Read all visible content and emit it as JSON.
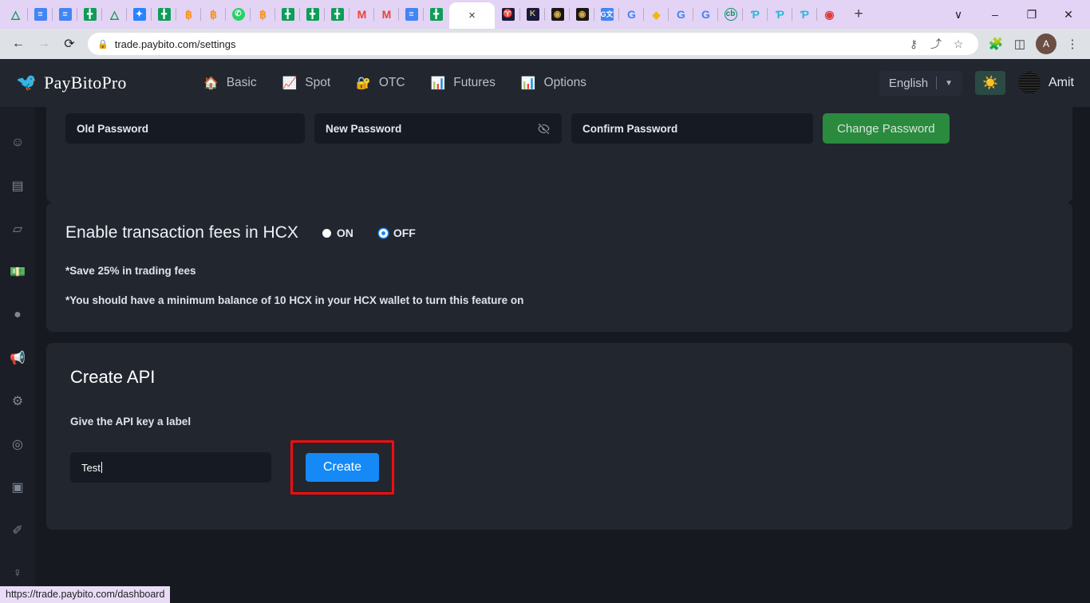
{
  "browser": {
    "tabs_mini": [
      {
        "name": "drive-tab",
        "icon": "drive-icon",
        "glyph": "△",
        "cls": "drive"
      },
      {
        "name": "docs-tab",
        "icon": "docs-icon",
        "glyph": "≡",
        "cls": "docs"
      },
      {
        "name": "docs-tab-2",
        "icon": "docs-icon",
        "glyph": "≡",
        "cls": "docs"
      },
      {
        "name": "sheets-tab",
        "icon": "sheets-icon",
        "glyph": "╋",
        "cls": "sheets"
      },
      {
        "name": "drive-tab-2",
        "icon": "drive-icon",
        "glyph": "△",
        "cls": "drive"
      },
      {
        "name": "jira-tab",
        "icon": "jira-icon",
        "glyph": "✦",
        "cls": "jira"
      },
      {
        "name": "sheets-tab-2",
        "icon": "sheets-icon",
        "glyph": "╋",
        "cls": "sheets"
      },
      {
        "name": "bitcoin-tab",
        "icon": "bitcoin-icon",
        "glyph": "฿",
        "cls": "btc"
      },
      {
        "name": "bitcoin-tab-2",
        "icon": "bitcoin-icon",
        "glyph": "฿",
        "cls": "btc"
      },
      {
        "name": "whatsapp-tab",
        "icon": "whatsapp-icon",
        "glyph": "✆",
        "cls": "wa"
      },
      {
        "name": "bitcoin-tab-3",
        "icon": "bitcoin-icon",
        "glyph": "฿",
        "cls": "btc"
      },
      {
        "name": "sheets-tab-3",
        "icon": "sheets-icon",
        "glyph": "╋",
        "cls": "sheets"
      },
      {
        "name": "sheets-tab-4",
        "icon": "sheets-icon",
        "glyph": "╋",
        "cls": "sheets"
      },
      {
        "name": "sheets-tab-5",
        "icon": "sheets-icon",
        "glyph": "╋",
        "cls": "sheets"
      },
      {
        "name": "gmail-tab",
        "icon": "gmail-icon",
        "glyph": "M",
        "cls": "gmail"
      },
      {
        "name": "gmail-tab-2",
        "icon": "gmail-icon",
        "glyph": "M",
        "cls": "gmail"
      },
      {
        "name": "docs-tab-3",
        "icon": "docs-icon",
        "glyph": "≡",
        "cls": "docs"
      },
      {
        "name": "sheets-tab-6",
        "icon": "sheets-icon",
        "glyph": "╋",
        "cls": "sheets"
      }
    ],
    "tabs_mini_right": [
      {
        "name": "paybito-tab",
        "icon": "paybito-icon",
        "glyph": "♈",
        "cls": "dark"
      },
      {
        "name": "kraken-tab",
        "icon": "kraken-icon",
        "glyph": "K",
        "cls": "dark"
      },
      {
        "name": "coin-tab",
        "icon": "coin-icon",
        "glyph": "◉",
        "cls": "gold"
      },
      {
        "name": "coin-tab-2",
        "icon": "coin-icon",
        "glyph": "◉",
        "cls": "gold"
      },
      {
        "name": "translate-tab",
        "icon": "google-translate-icon",
        "glyph": "G文",
        "cls": "gtrans"
      },
      {
        "name": "google-tab",
        "icon": "google-icon",
        "glyph": "G",
        "cls": "goog"
      },
      {
        "name": "binance-tab",
        "icon": "binance-icon",
        "glyph": "◆",
        "cls": "binance"
      },
      {
        "name": "google-tab-2",
        "icon": "google-icon",
        "glyph": "G",
        "cls": "goog"
      },
      {
        "name": "google-tab-3",
        "icon": "google-icon",
        "glyph": "G",
        "cls": "goog"
      },
      {
        "name": "coinbase-tab",
        "icon": "coinbase-icon",
        "glyph": "cb",
        "cls": "coinb"
      },
      {
        "name": "paybito-tab-2",
        "icon": "paybito-icon",
        "glyph": "Ƥ",
        "cls": "pay"
      },
      {
        "name": "paybito-tab-3",
        "icon": "paybito-icon",
        "glyph": "Ƥ",
        "cls": "pay"
      },
      {
        "name": "paybito-tab-4",
        "icon": "paybito-icon",
        "glyph": "Ƥ",
        "cls": "pay"
      },
      {
        "name": "record-tab",
        "icon": "record-icon",
        "glyph": "◉",
        "cls": "rec"
      }
    ],
    "active_tab_close": "×",
    "new_tab": "+",
    "window_controls": {
      "list": "∨",
      "minimize": "–",
      "maximize": "❐",
      "close": "✕"
    },
    "back": "←",
    "forward": "→",
    "reload": "⟳",
    "lock": "🔒",
    "url": "trade.paybito.com/settings",
    "omnibox_icons": {
      "password_key": "⚷",
      "share": "⤴",
      "bookmark": "☆"
    },
    "toolbar_icons": {
      "extensions": "🧩",
      "sidepanel": "◫",
      "menu": "⋮"
    },
    "profile_initial": "A"
  },
  "app_header": {
    "brand_logo_icon": "swallow-bird-logo",
    "brand_name": "PayBitoPro",
    "nav": [
      {
        "label": "Basic",
        "icon": "🏠"
      },
      {
        "label": "Spot",
        "icon": "📈"
      },
      {
        "label": "OTC",
        "icon": "🔐"
      },
      {
        "label": "Futures",
        "icon": "📊"
      },
      {
        "label": "Options",
        "icon": "📊"
      }
    ],
    "language": "English",
    "language_caret": "▼",
    "theme_icon": "☀",
    "user_name": "Amit"
  },
  "sidebar": {
    "items": [
      {
        "name": "profile",
        "icon": "ⓘ",
        "glyph": "☺"
      },
      {
        "name": "cards",
        "icon": "card-icon",
        "glyph": "▤"
      },
      {
        "name": "deposit",
        "icon": "folder-icon",
        "glyph": "▱"
      },
      {
        "name": "wallet",
        "icon": "wallet-icon",
        "glyph": "💵"
      },
      {
        "name": "token",
        "icon": "token-icon",
        "glyph": "●"
      },
      {
        "name": "announcements",
        "icon": "megaphone-icon",
        "glyph": "📢"
      },
      {
        "name": "settings",
        "icon": "gear-icon",
        "glyph": "⚙"
      },
      {
        "name": "security",
        "icon": "shield-icon",
        "glyph": "◎"
      },
      {
        "name": "kyc",
        "icon": "id-card-icon",
        "glyph": "▣"
      },
      {
        "name": "referral",
        "icon": "tag-icon",
        "glyph": "✐"
      },
      {
        "name": "support",
        "icon": "help-icon",
        "glyph": "♀"
      }
    ]
  },
  "password_section": {
    "old_password_placeholder": "Old Password",
    "new_password_placeholder": "New Password",
    "confirm_password_placeholder": "Confirm Password",
    "eye_icon": "eye-off-icon",
    "change_button": "Change Password",
    "change_button_color": "#2a8a3e"
  },
  "hcx_section": {
    "title": "Enable transaction fees in HCX",
    "options": [
      {
        "label": "ON",
        "selected": false
      },
      {
        "label": "OFF",
        "selected": true
      }
    ],
    "selected_color": "#1b86f5",
    "note_1": "*Save 25% in trading fees",
    "note_2": "*You should have a minimum balance of 10 HCX in your HCX wallet to turn this feature on"
  },
  "api_section": {
    "title": "Create API",
    "label": "Give the API key a label",
    "input_value": "Test",
    "create_button": "Create",
    "create_button_color": "#1589f5",
    "highlight_color": "#f40d0d"
  },
  "status_bar": {
    "url": "https://trade.paybito.com/dashboard"
  }
}
